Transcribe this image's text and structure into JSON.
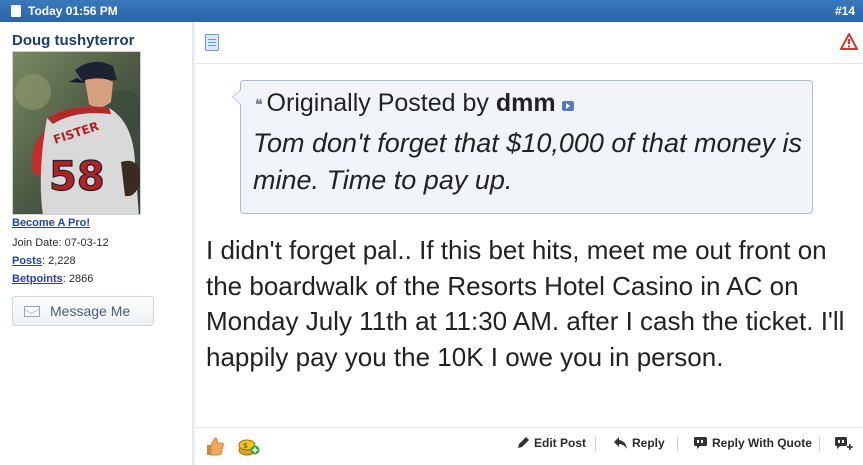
{
  "post_header": {
    "date": "Today 01:56 PM",
    "post_number": "#14"
  },
  "user": {
    "username": "Doug tushyterror",
    "avatar_jersey_name": "FISTER",
    "avatar_jersey_number": "58",
    "become_pro": "Become A Pro!",
    "join_date_label": "Join Date:",
    "join_date": "07-03-12",
    "posts_label": "Posts",
    "posts": "2,228",
    "betpoints_label": "Betpoints",
    "betpoints": "2866",
    "message_button": "Message Me"
  },
  "quote": {
    "prefix": "Originally Posted by",
    "author": "dmm",
    "text": "Tom don't forget that $10,000 of that money is mine. Time to pay up."
  },
  "post_body": "I didn't forget pal.. If this bet hits, meet me out front on the boardwalk of the Resorts Hotel Casino in AC on Monday July 11th at 11:30 AM. after I cash the ticket. I'll happily pay you the 10K I owe you in person.",
  "actions": {
    "edit": "Edit Post",
    "reply": "Reply",
    "reply_with_quote": "Reply With Quote"
  },
  "icons": [
    "document-icon",
    "post-icon",
    "warning-icon",
    "thumbs-up-icon",
    "coins-icon",
    "envelope-icon",
    "pencil-icon",
    "reply-arrow-icon",
    "quote-bubble-icon",
    "multi-quote-icon"
  ],
  "colors": {
    "header_bar": "#2c64a6",
    "username": "#1c3e6b",
    "link": "#2144b5",
    "quote_bg": "#f1f5f9",
    "quote_border": "#a9bed3",
    "warning": "#d9342b"
  }
}
